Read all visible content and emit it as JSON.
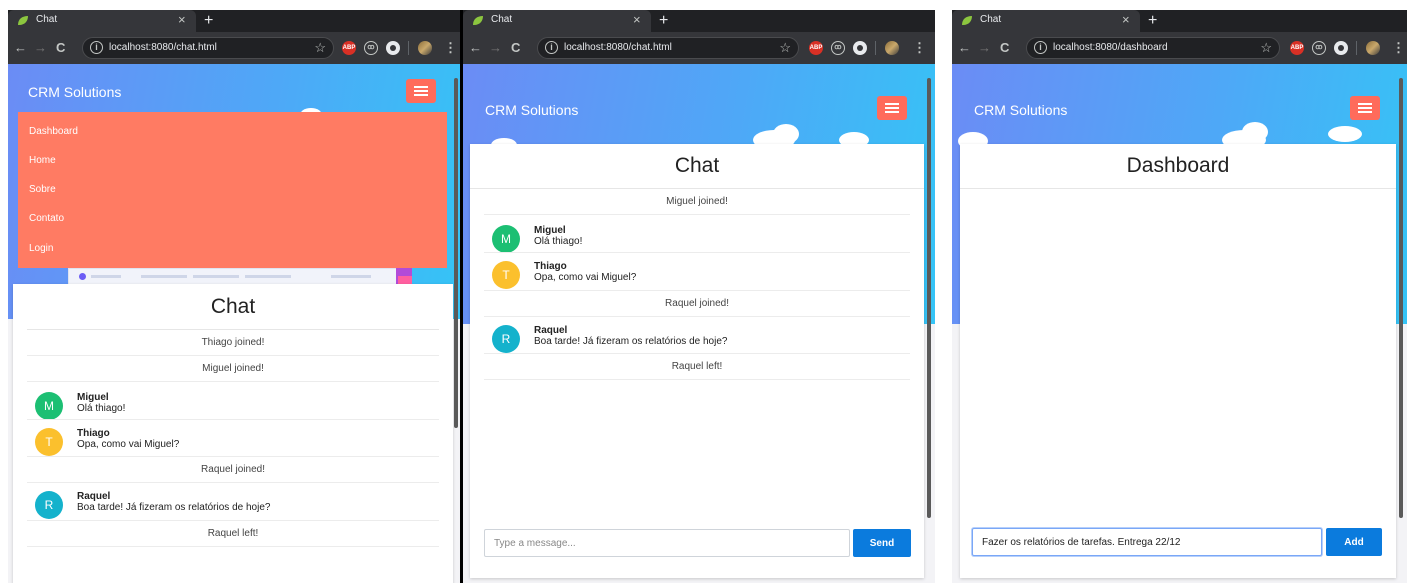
{
  "colors": {
    "accent_coral": "#ff6b5b",
    "menu_bg": "#ff7b63",
    "send_blue": "#0b7bdd",
    "avatar_miguel": "#1cbf73",
    "avatar_thiago": "#fbc02d",
    "avatar_raquel": "#14b2cc"
  },
  "browser": {
    "new_tab": "+",
    "back": "←",
    "forward": "→",
    "reload": "C",
    "star": "☆",
    "close": "×",
    "ext_abp": "ABP",
    "ext_ublock": "ꝏ",
    "menu": "⋮"
  },
  "windows": [
    {
      "tab_title": "Chat",
      "url": "localhost:8080/chat.html",
      "brand": "CRM Solutions",
      "menu": [
        "Dashboard",
        "Home",
        "Sobre",
        "Contato",
        "Login"
      ],
      "card_title": "Chat",
      "messages": [
        {
          "type": "system",
          "text": "Thiago joined!"
        },
        {
          "type": "system",
          "text": "Miguel joined!"
        },
        {
          "type": "chat",
          "initial": "M",
          "name": "Miguel",
          "text": "Olá thiago!"
        },
        {
          "type": "chat",
          "initial": "T",
          "name": "Thiago",
          "text": "Opa, como vai Miguel?"
        },
        {
          "type": "system",
          "text": "Raquel joined!"
        },
        {
          "type": "chat",
          "initial": "R",
          "name": "Raquel",
          "text": "Boa tarde! Já fizeram os relatórios de hoje?"
        },
        {
          "type": "system",
          "text": "Raquel left!"
        }
      ]
    },
    {
      "tab_title": "Chat",
      "url": "localhost:8080/chat.html",
      "brand": "CRM Solutions",
      "card_title": "Chat",
      "messages": [
        {
          "type": "system",
          "text": "Miguel joined!"
        },
        {
          "type": "chat",
          "initial": "M",
          "name": "Miguel",
          "text": "Olá thiago!"
        },
        {
          "type": "chat",
          "initial": "T",
          "name": "Thiago",
          "text": "Opa, como vai Miguel?"
        },
        {
          "type": "system",
          "text": "Raquel joined!"
        },
        {
          "type": "chat",
          "initial": "R",
          "name": "Raquel",
          "text": "Boa tarde! Já fizeram os relatórios de hoje?"
        },
        {
          "type": "system",
          "text": "Raquel left!"
        }
      ],
      "input_placeholder": "Type a message...",
      "send_label": "Send"
    },
    {
      "tab_title": "Chat",
      "url": "localhost:8080/dashboard",
      "brand": "CRM Solutions",
      "card_title": "Dashboard",
      "input_value": "Fazer os relatórios de tarefas. Entrega 22/12",
      "add_label": "Add"
    }
  ]
}
